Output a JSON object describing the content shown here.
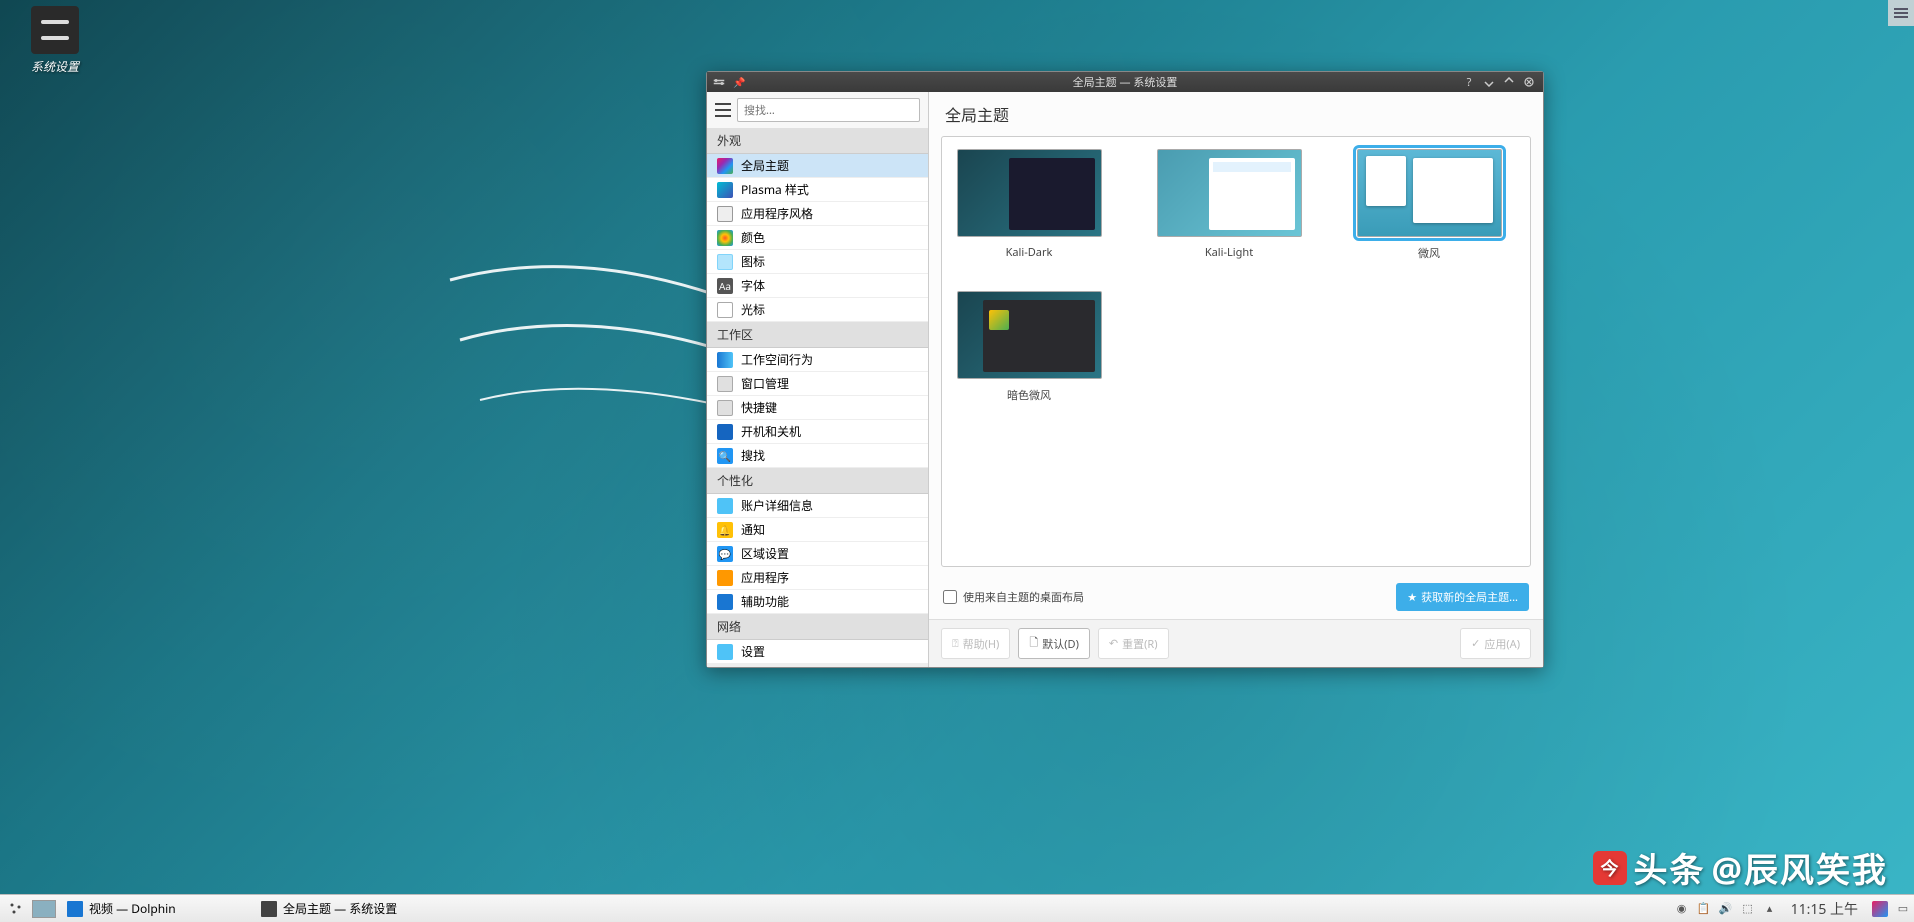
{
  "desktop": {
    "icon_label": "系统设置"
  },
  "window": {
    "title": "全局主题 — 系统设置"
  },
  "sidebar": {
    "search_placeholder": "搜找...",
    "sections": [
      {
        "header": "外观",
        "items": [
          {
            "label": "全局主题",
            "icon": "ic-theme",
            "selected": true
          },
          {
            "label": "Plasma 样式",
            "icon": "ic-plasma"
          },
          {
            "label": "应用程序风格",
            "icon": "ic-appstyle"
          },
          {
            "label": "颜色",
            "icon": "ic-colors"
          },
          {
            "label": "图标",
            "icon": "ic-icons"
          },
          {
            "label": "字体",
            "icon": "ic-fonts"
          },
          {
            "label": "光标",
            "icon": "ic-cursor"
          }
        ]
      },
      {
        "header": "工作区",
        "items": [
          {
            "label": "工作空间行为",
            "icon": "ic-workbeh"
          },
          {
            "label": "窗口管理",
            "icon": "ic-windowmgmt"
          },
          {
            "label": "快捷键",
            "icon": "ic-shortcut"
          },
          {
            "label": "开机和关机",
            "icon": "ic-startup"
          },
          {
            "label": "搜找",
            "icon": "ic-search"
          }
        ]
      },
      {
        "header": "个性化",
        "items": [
          {
            "label": "账户详细信息",
            "icon": "ic-account"
          },
          {
            "label": "通知",
            "icon": "ic-notify"
          },
          {
            "label": "区域设置",
            "icon": "ic-region"
          },
          {
            "label": "应用程序",
            "icon": "ic-apps"
          },
          {
            "label": "辅助功能",
            "icon": "ic-access"
          }
        ]
      },
      {
        "header": "网络",
        "items": [
          {
            "label": "设置",
            "icon": "ic-net"
          }
        ]
      }
    ]
  },
  "content": {
    "title": "全局主题",
    "themes": [
      {
        "label": "Kali-Dark",
        "thumb": "thumb-kali-dark"
      },
      {
        "label": "Kali-Light",
        "thumb": "thumb-kali-light"
      },
      {
        "label": "微风",
        "thumb": "thumb-breeze",
        "selected": true
      },
      {
        "label": "暗色微风",
        "thumb": "thumb-breeze-dark"
      }
    ],
    "use_layout_checkbox": "使用来自主题的桌面布局",
    "get_new_btn": "获取新的全局主题..."
  },
  "footer": {
    "help": "帮助(H)",
    "default": "默认(D)",
    "reset": "重置(R)",
    "apply": "应用(A)"
  },
  "taskbar": {
    "task1": "视频 — Dolphin",
    "task2": "全局主题 — 系统设置",
    "clock": "11:15 上午"
  },
  "watermark": {
    "prefix": "头条",
    "text": "@辰风笑我"
  }
}
